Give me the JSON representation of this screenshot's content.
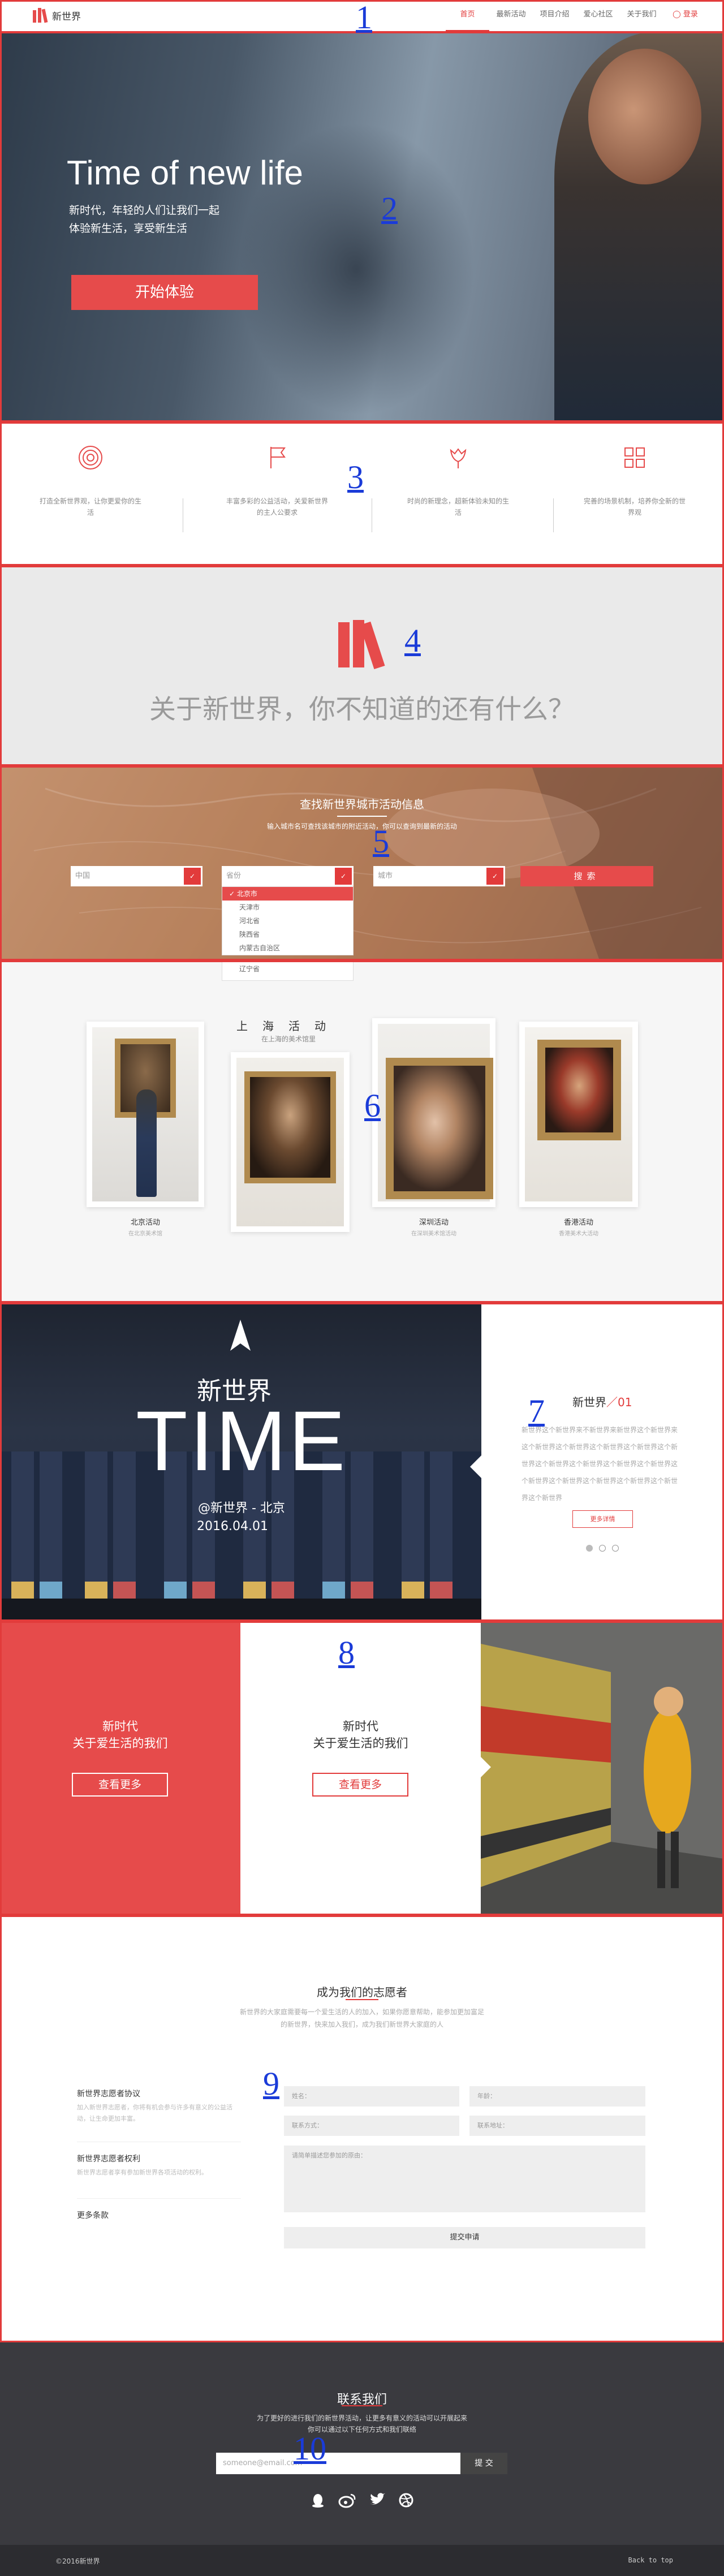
{
  "nav": {
    "logo_text": "新世界",
    "items": [
      "首页",
      "最新活动",
      "项目介绍",
      "爱心社区",
      "关于我们"
    ],
    "login": "登录"
  },
  "hero": {
    "title": "Time of new life",
    "sub1": "新时代，年轻的人们让我们一起",
    "sub2": "体验新生活，享受新生活",
    "button": "开始体验"
  },
  "features": [
    {
      "icon": "target-icon",
      "text": "打造全新世界观，让你更爱你的生活"
    },
    {
      "icon": "flag-icon",
      "text": "丰富多彩的公益活动，关爱新世界的主人公要求"
    },
    {
      "icon": "tulip-icon",
      "text": "时尚的新理念，超新体验未知的生活"
    },
    {
      "icon": "grid-icon",
      "text": "完善的场景机制，培养你全新的世界观"
    }
  ],
  "about": {
    "title": "关于新世界，你不知道的还有什么？"
  },
  "search": {
    "title": "查找新世界城市活动信息",
    "subtitle": "输入城市名可查找该城市的附近活动，你可以查询到最新的活动",
    "country": "中国",
    "province": "省份",
    "city": "城市",
    "button": "搜索",
    "dropdown": [
      "北京市",
      "天津市",
      "河北省",
      "陕西省",
      "内蒙古自治区",
      "辽宁省"
    ],
    "dropdown_selected": 0
  },
  "gallery": {
    "heading": "上海活动",
    "heading_sub": "在上海的美术馆里",
    "items": [
      {
        "name": "北京活动",
        "sub": "在北京美术馆"
      },
      {
        "name": "深圳活动",
        "sub": "在深圳美术馆活动"
      },
      {
        "name": "香港活动",
        "sub": "香港美术大活动"
      }
    ]
  },
  "time": {
    "small": "新世界",
    "big": "TIME",
    "location": "@新世界 - 北京",
    "date": "2016.04.01",
    "headline": "新世界",
    "slash": "／01",
    "body": "新世界这个新世界来不新世界来新世界这个新世界来这个新世界这个新世界这个新世界这个新世界这个新世界这个新世界这个新世界这个新世界这个新世界这个新世界这个新世界这个新世界这个新世界这个新世界这个新世界",
    "button": "更多详情",
    "dots": 3,
    "active_dot": 0
  },
  "blocks": {
    "line1": "新时代",
    "line2": "关于爱生活的我们",
    "button": "查看更多"
  },
  "volunteer": {
    "title": "成为我们的志愿者",
    "subtitle": "新世界的大家庭需要每一个爱生活的人的加入，如果你愿意帮助，能参加更加富足的新世界，快来加入我们，成为我们新世界大家庭的人",
    "links": [
      {
        "title": "新世界志愿者协议",
        "body": "加入新世界志愿者，你将有机会参与许多有意义的公益活动，让生命更加丰富。"
      },
      {
        "title": "新世界志愿者权利",
        "body": "新世界志愿者享有参加新世界各项活动的权利。"
      },
      {
        "title": "更多条款",
        "body": ""
      }
    ],
    "fields": {
      "name": "姓名：",
      "age": "年龄：",
      "phone": "联系方式：",
      "address": "联系地址：",
      "message": "请简单描述您参加的原由："
    },
    "submit": "提交申请"
  },
  "contact": {
    "title": "联系我们",
    "sub1": "为了更好的进行我们的新世界活动，让更多有意义的活动可以开展起来",
    "sub2": "你可以通过以下任何方式和我们联络",
    "email_placeholder": "someone@email.com",
    "button": "提 交"
  },
  "footer": {
    "copyright": "©2016新世界",
    "back": "Back to top"
  },
  "annotations": [
    "1",
    "2",
    "3",
    "4",
    "5",
    "6",
    "7",
    "8",
    "9",
    "10"
  ],
  "colors": {
    "accent": "#e64b4b",
    "annotation": "#1a3bd8"
  }
}
